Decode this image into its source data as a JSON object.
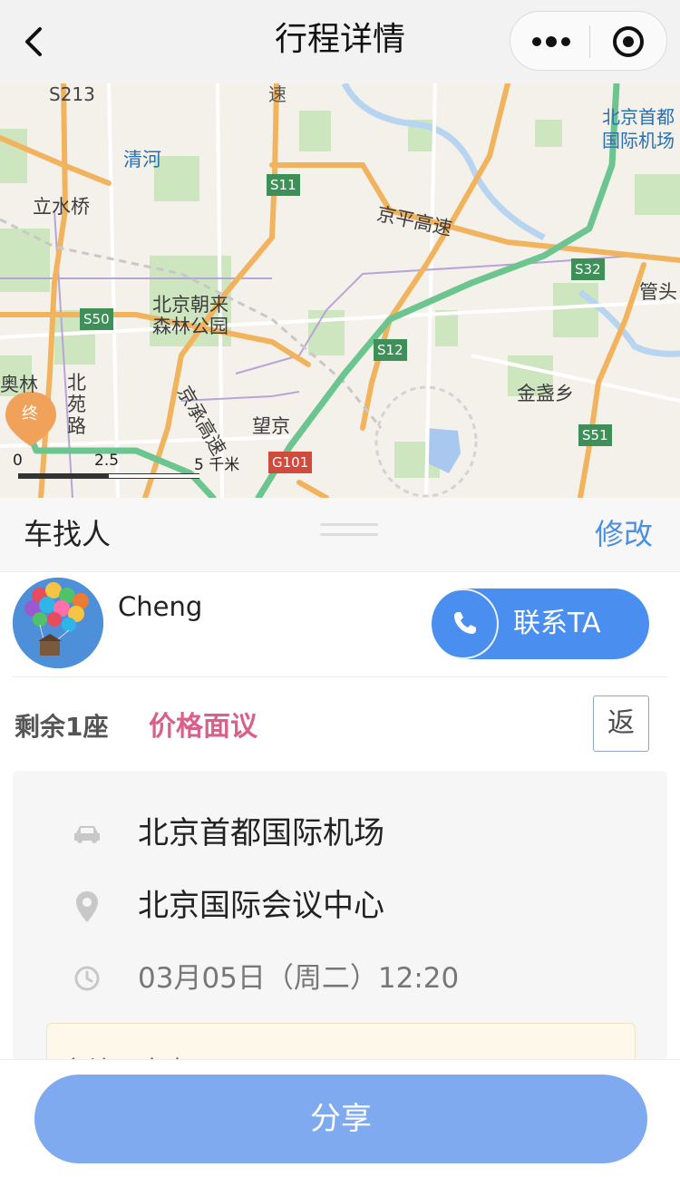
{
  "nav": {
    "title": "行程详情",
    "back_icon": "chevron-left-icon",
    "more_icon": "more-dots-icon",
    "close_icon": "target-close-icon"
  },
  "map": {
    "labels": {
      "s213": "S213",
      "su": "速",
      "qinghe": "清河",
      "lishuiqiao": "立水桥",
      "s11": "S11",
      "jingping": "京平高速",
      "airport": "北京首都国际机场",
      "s32": "S32",
      "guantou": "管头",
      "chaolai": "北京朝来森林公园",
      "s50": "S50",
      "s12": "S12",
      "jinzhan": "金盏乡",
      "aolin": "奥林",
      "beiyuan": "北苑路",
      "jingcheng": "京承高速",
      "wangjing": "望京",
      "s51": "S51",
      "g101": "G101",
      "end_marker": "终"
    },
    "scale": {
      "s0": "0",
      "s1": "2.5",
      "s2": "5 千米"
    },
    "route_color": "#6cc48f"
  },
  "panel": {
    "title": "车找人",
    "edit_label": "修改"
  },
  "driver": {
    "name": "Cheng",
    "contact_label": "联系TA"
  },
  "trip": {
    "seats": "剩余1座",
    "price": "价格面议",
    "return_tag": "返",
    "start": "北京首都国际机场",
    "end": "北京国际会议中心",
    "time": "03月05日（周二）12:20",
    "note": "备注：宝宝"
  },
  "footer": {
    "share_label": "分享",
    "share_color": "#7faaf0"
  }
}
